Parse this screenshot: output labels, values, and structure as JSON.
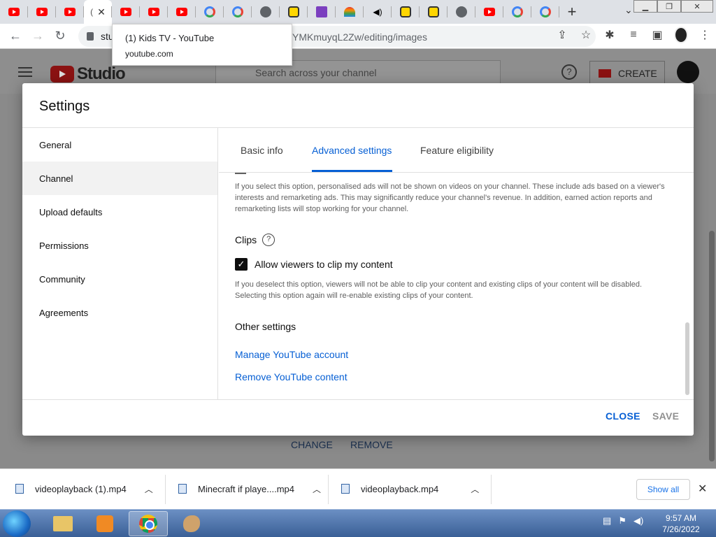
{
  "browser": {
    "tabs": [
      {
        "icon": "youtube-icon"
      },
      {
        "icon": "youtube-icon"
      },
      {
        "icon": "youtube-icon"
      },
      {
        "icon": "loading-icon",
        "active": true
      },
      {
        "icon": "youtube-icon"
      },
      {
        "icon": "youtube-icon"
      },
      {
        "icon": "youtube-icon"
      },
      {
        "icon": "google-icon"
      },
      {
        "icon": "google-icon"
      },
      {
        "icon": "globe-icon"
      },
      {
        "icon": "smiley-icon"
      },
      {
        "icon": "tumblr-icon"
      },
      {
        "icon": "rainbow-icon"
      },
      {
        "icon": "audio-icon"
      },
      {
        "icon": "smiley-icon"
      },
      {
        "icon": "smiley-icon"
      },
      {
        "icon": "globe-icon"
      },
      {
        "icon": "youtube-icon"
      },
      {
        "icon": "google-icon"
      },
      {
        "icon": "google-icon"
      }
    ],
    "url_prefix": "stu",
    "url_tail": "YMKmuyqL2Zw/editing/images"
  },
  "tooltip": {
    "title": "(1) Kids TV - YouTube",
    "domain": "youtube.com"
  },
  "studio": {
    "logo_text": "Studio",
    "search_placeholder": "Search across your channel",
    "create_label": "CREATE",
    "change_label": "CHANGE",
    "remove_label": "REMOVE"
  },
  "modal": {
    "title": "Settings",
    "nav": [
      "General",
      "Channel",
      "Upload defaults",
      "Permissions",
      "Community",
      "Agreements"
    ],
    "selected_nav": "Channel",
    "tabs": [
      "Basic info",
      "Advanced settings",
      "Feature eligibility"
    ],
    "active_tab": "Advanced settings",
    "ads_description": "If you select this option, personalised ads will not be shown on videos on your channel. These include ads based on a viewer's interests and remarketing ads. This may significantly reduce your channel's revenue. In addition, earned action reports and remarketing lists will stop working for your channel.",
    "clips_heading": "Clips",
    "clips_checkbox_label": "Allow viewers to clip my content",
    "clips_checked": true,
    "clips_description": "If you deselect this option, viewers will not be able to clip your content and existing clips of your content will be disabled. Selecting this option again will re-enable existing clips of your content.",
    "other_heading": "Other settings",
    "link_manage": "Manage YouTube account",
    "link_remove": "Remove YouTube content",
    "close_label": "CLOSE",
    "save_label": "SAVE"
  },
  "downloads": {
    "items": [
      "videoplayback (1).mp4",
      "Minecraft if playe....mp4",
      "videoplayback.mp4"
    ],
    "show_all": "Show all"
  },
  "taskbar": {
    "time": "9:57 AM",
    "date": "7/26/2022"
  },
  "colors": {
    "accent": "#065fd4",
    "youtube_red": "#ff0000"
  }
}
